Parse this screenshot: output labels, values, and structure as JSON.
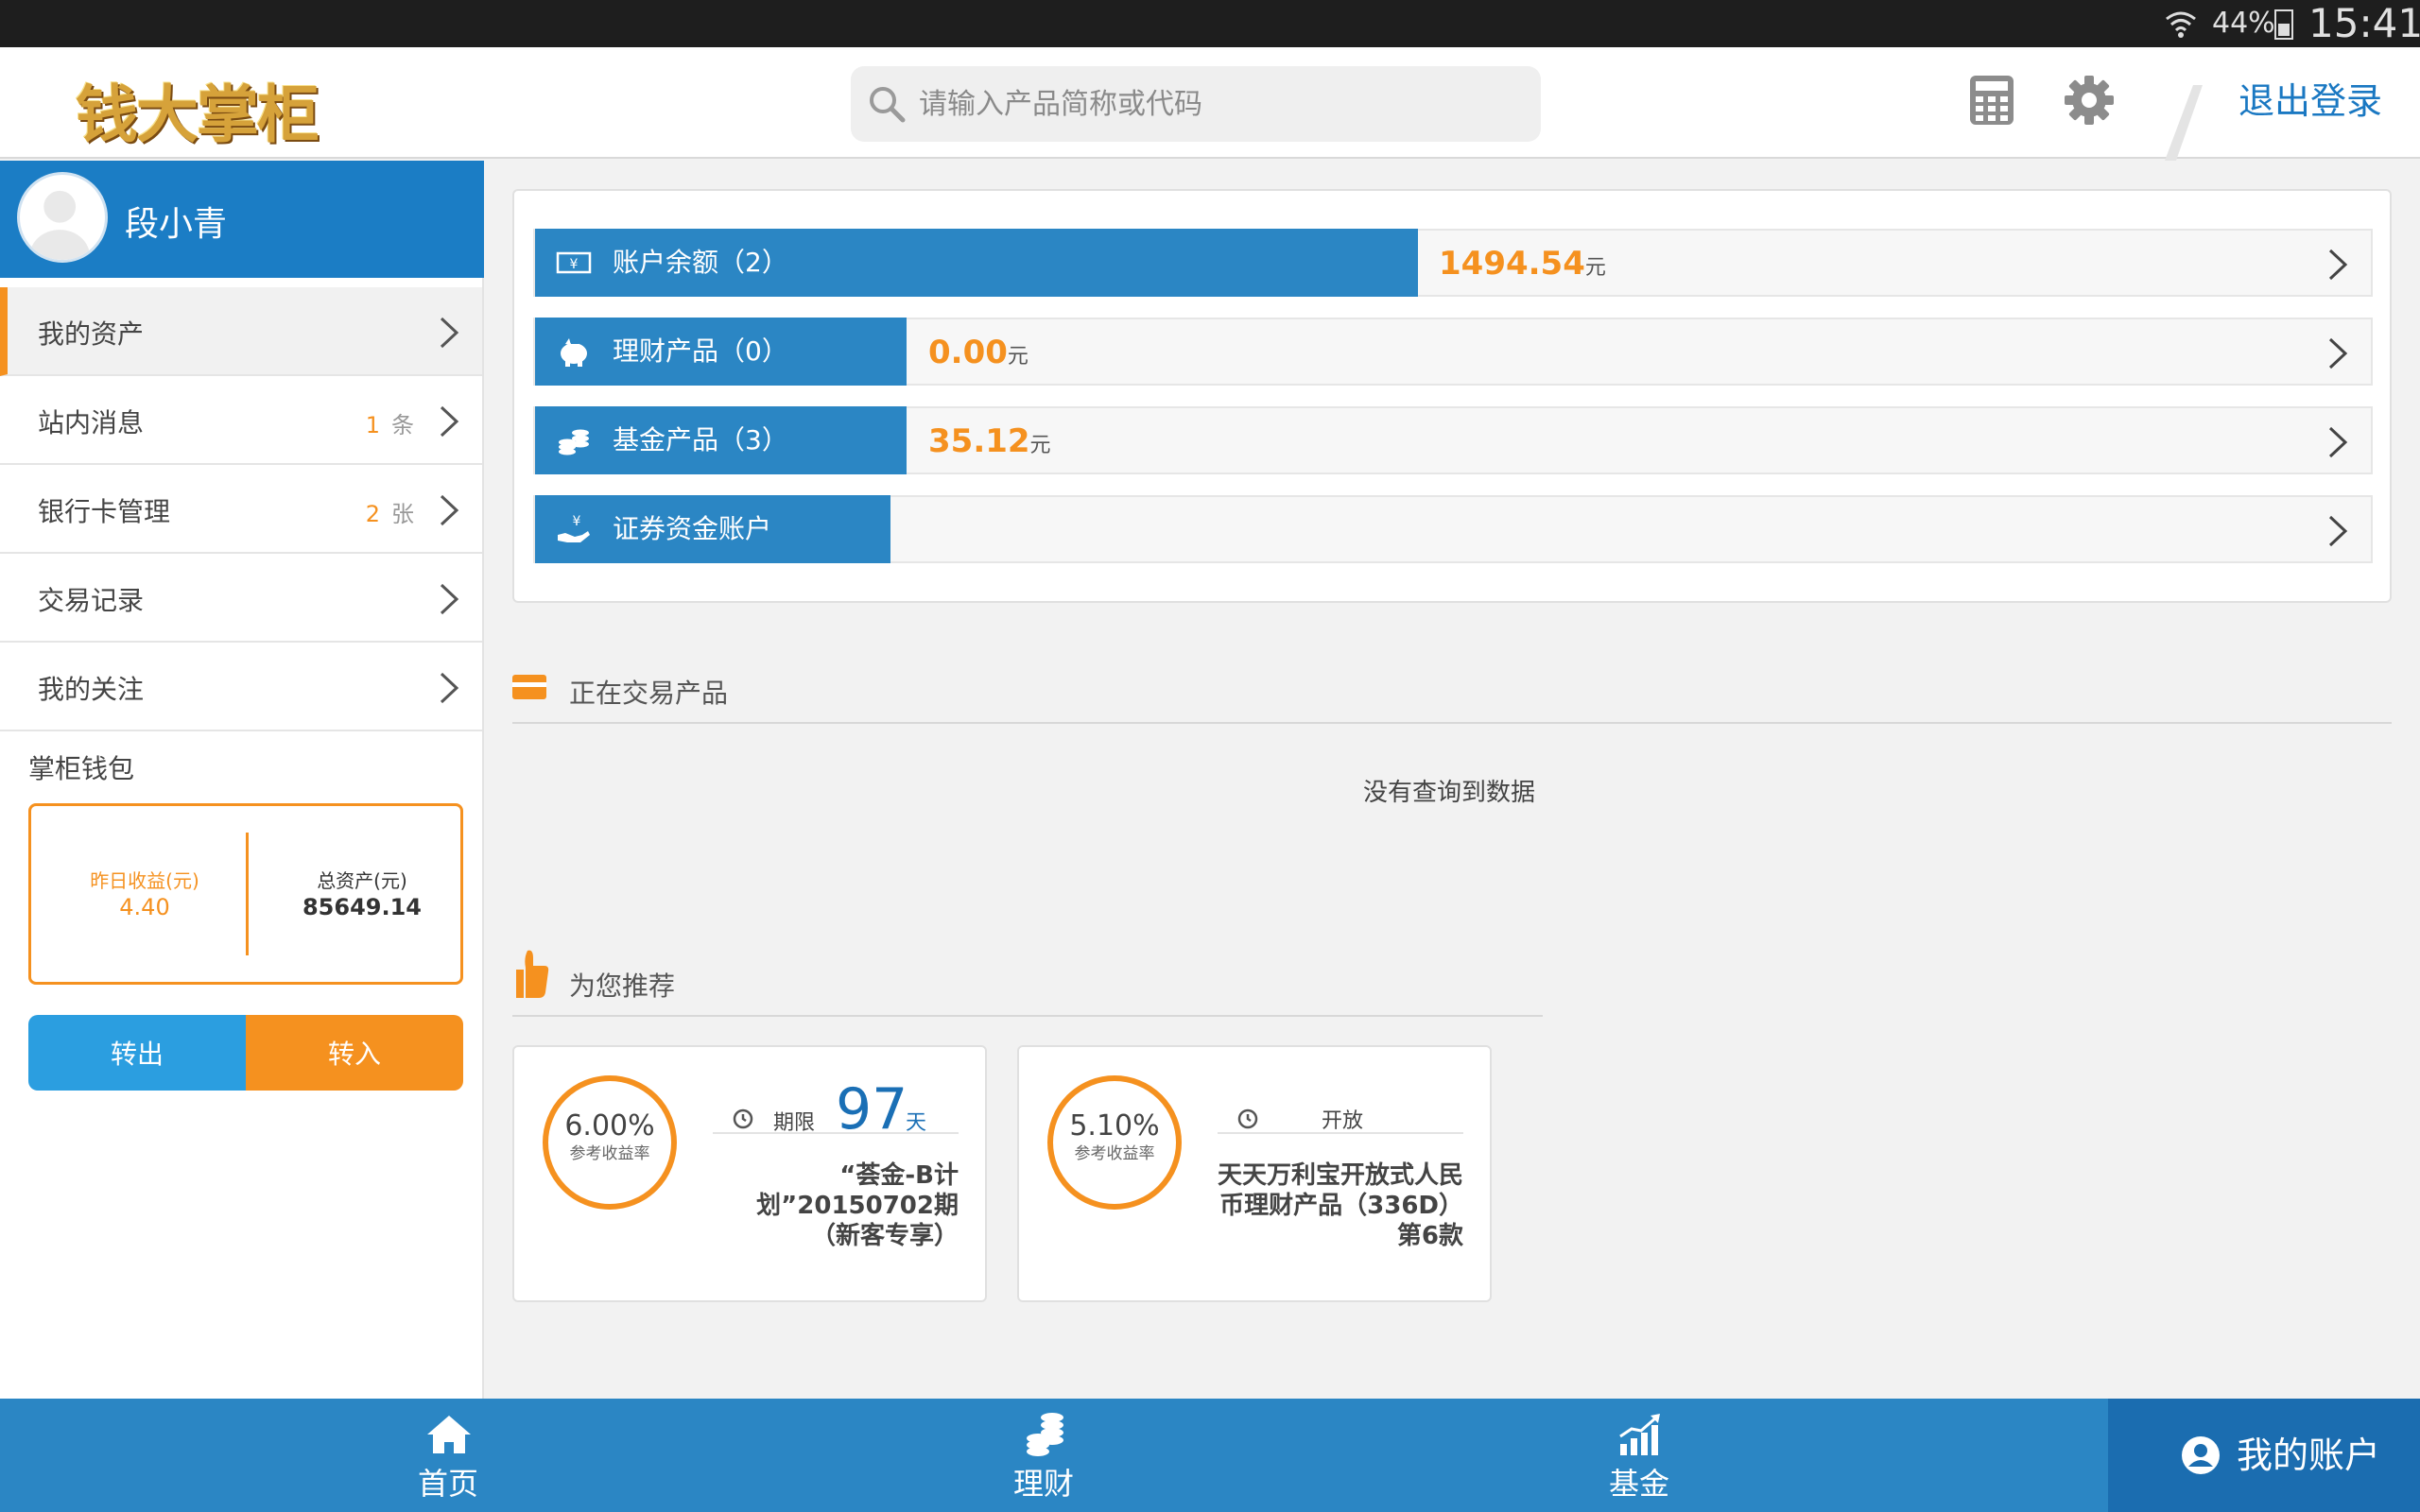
{
  "status_bar": {
    "battery": "44%",
    "time": "15:41"
  },
  "header": {
    "logo_text": "钱大掌柜",
    "search_placeholder": "请输入产品简称或代码",
    "logout_label": "退出登录"
  },
  "sidebar": {
    "user_name": "段小青",
    "menu": [
      {
        "label": "我的资产",
        "count": "",
        "unit": ""
      },
      {
        "label": "站内消息",
        "count": "1",
        "unit": "条"
      },
      {
        "label": "银行卡管理",
        "count": "2",
        "unit": "张"
      },
      {
        "label": "交易记录",
        "count": "",
        "unit": ""
      },
      {
        "label": "我的关注",
        "count": "",
        "unit": ""
      }
    ],
    "wallet": {
      "title": "掌柜钱包",
      "yesterday_label": "昨日收益(元)",
      "yesterday_value": "4.40",
      "total_label": "总资产(元)",
      "total_value": "85649.14",
      "transfer_out": "转出",
      "transfer_in": "转入"
    }
  },
  "accounts": [
    {
      "label": "账户余额（2）",
      "value": "1494.54",
      "unit": "元",
      "icon": "cash-icon"
    },
    {
      "label": "理财产品（0）",
      "value": "0.00",
      "unit": "元",
      "icon": "piggy-bank-icon"
    },
    {
      "label": "基金产品（3）",
      "value": "35.12",
      "unit": "元",
      "icon": "coins-icon"
    },
    {
      "label": "证券资金账户",
      "value": "",
      "unit": "",
      "icon": "hand-yen-icon"
    }
  ],
  "trading": {
    "title": "正在交易产品",
    "empty_text": "没有查询到数据"
  },
  "recommend": {
    "title": "为您推荐",
    "items": [
      {
        "rate": "6.00%",
        "rate_label": "参考收益率",
        "term_label": "期限",
        "term_value": "97",
        "term_unit": "天",
        "name": "“荟金-B计划”20150702期（新客专享）"
      },
      {
        "rate": "5.10%",
        "rate_label": "参考收益率",
        "term_label": "开放",
        "name": "天天万利宝开放式人民币理财产品（336D）第6款"
      }
    ]
  },
  "bottom_nav": {
    "home": "首页",
    "finance": "理财",
    "fund": "基金",
    "account": "我的账户"
  },
  "colors": {
    "primary_blue": "#2b86c4",
    "accent_orange": "#f5911f"
  }
}
